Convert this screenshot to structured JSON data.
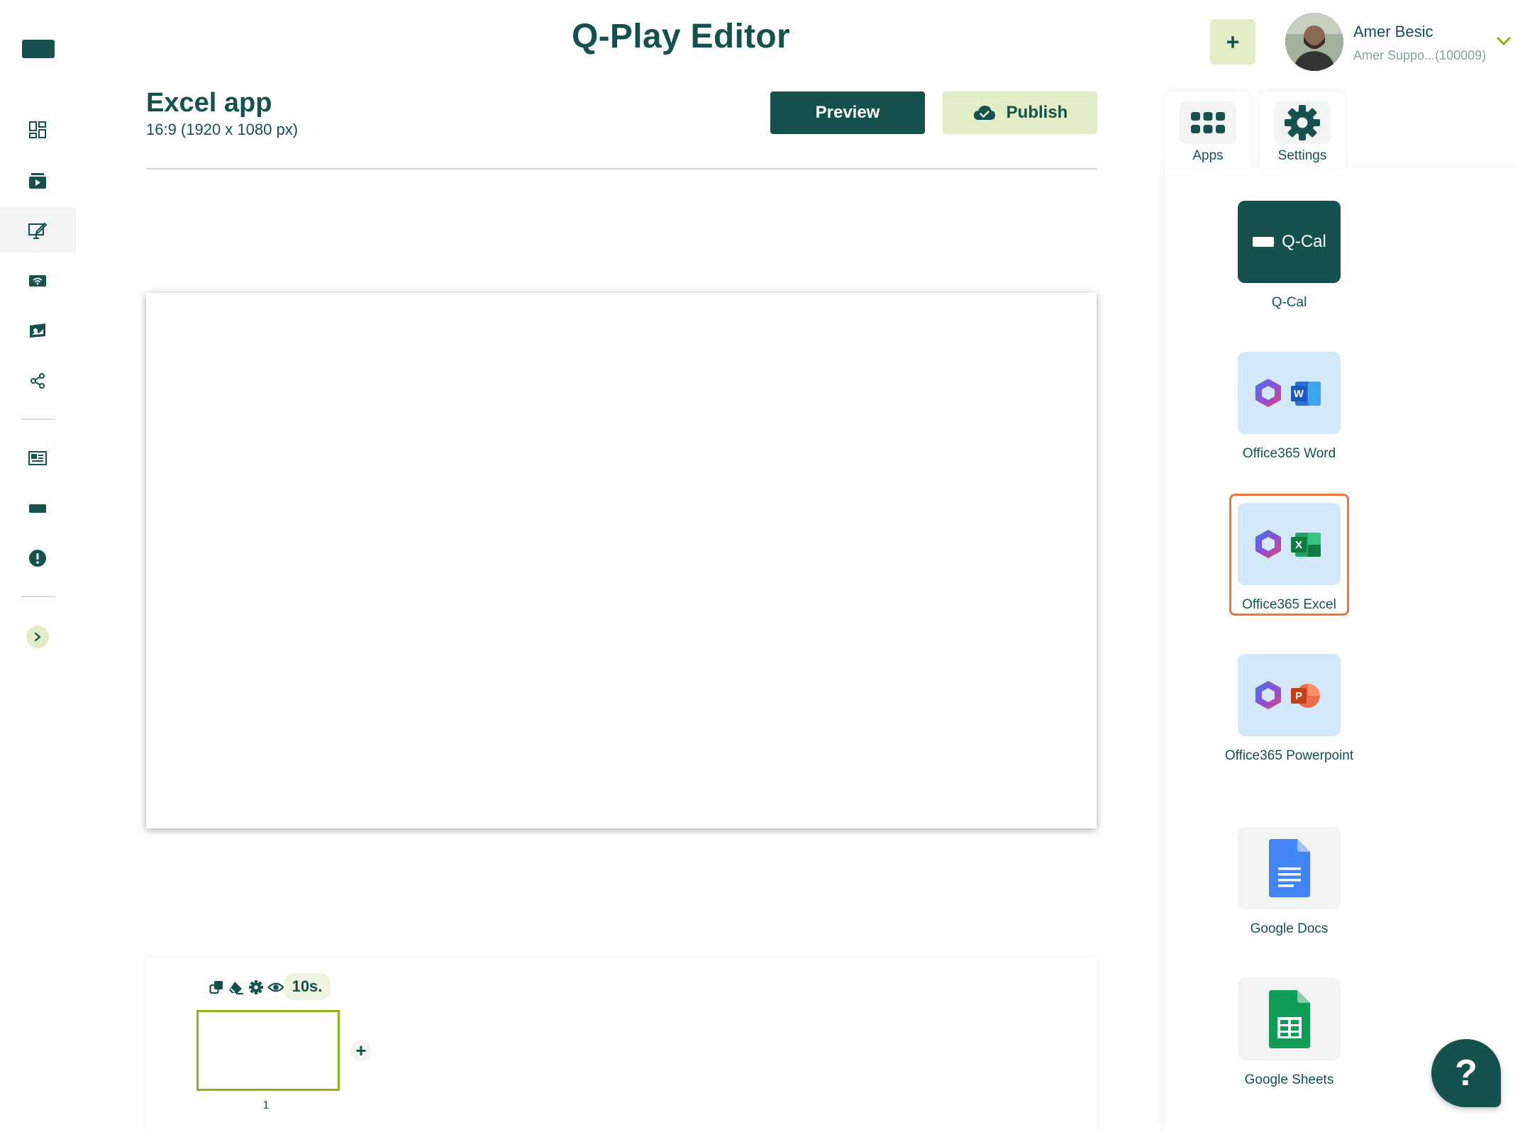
{
  "header": {
    "title": "Q-Play Editor",
    "add_label": "+",
    "user": {
      "name": "Amer Besic",
      "account": "Amer Suppo...(100009)"
    }
  },
  "editor": {
    "doc_title": "Excel app",
    "doc_size": "16:9 (1920 x 1080 px)",
    "preview_label": "Preview",
    "publish_label": "Publish"
  },
  "timeline": {
    "duration": "10s.",
    "slides": [
      {
        "number": "1"
      }
    ],
    "add_label": "+"
  },
  "panel": {
    "tabs": [
      {
        "label": "Apps",
        "icon": "apps-grid-icon"
      },
      {
        "label": "Settings",
        "icon": "gear-icon"
      }
    ],
    "apps": [
      {
        "label": "Q-Cal",
        "tile_text": "Q-Cal"
      },
      {
        "label": "Office365 Word"
      },
      {
        "label": "Office365 Excel",
        "selected": true
      },
      {
        "label": "Office365 Powerpoint"
      },
      {
        "label": "Google Docs"
      },
      {
        "label": "Google Sheets"
      }
    ]
  },
  "help_label": "?",
  "colors": {
    "brand_dark": "#15514d",
    "brand_light": "#e3edc5",
    "accent_green": "#8fb31c",
    "selection": "#f0763f"
  }
}
